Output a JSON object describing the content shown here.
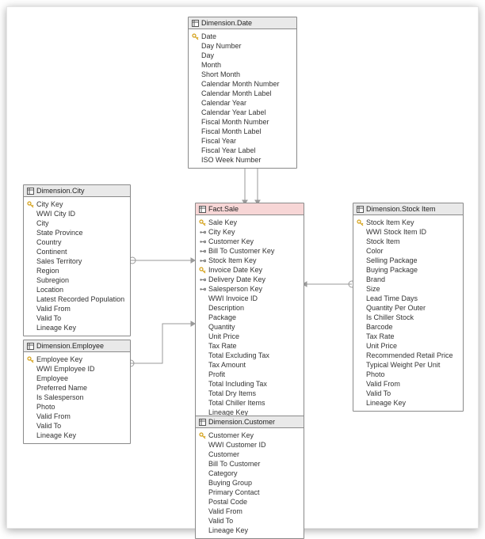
{
  "tables": {
    "date": {
      "title": "Dimension.Date",
      "columns": [
        {
          "name": "Date",
          "icon": "pk"
        },
        {
          "name": "Day Number",
          "icon": "none"
        },
        {
          "name": "Day",
          "icon": "none"
        },
        {
          "name": "Month",
          "icon": "none"
        },
        {
          "name": "Short Month",
          "icon": "none"
        },
        {
          "name": "Calendar Month Number",
          "icon": "none"
        },
        {
          "name": "Calendar Month Label",
          "icon": "none"
        },
        {
          "name": "Calendar Year",
          "icon": "none"
        },
        {
          "name": "Calendar Year Label",
          "icon": "none"
        },
        {
          "name": "Fiscal Month Number",
          "icon": "none"
        },
        {
          "name": "Fiscal Month Label",
          "icon": "none"
        },
        {
          "name": "Fiscal Year",
          "icon": "none"
        },
        {
          "name": "Fiscal Year Label",
          "icon": "none"
        },
        {
          "name": "ISO Week Number",
          "icon": "none"
        }
      ]
    },
    "city": {
      "title": "Dimension.City",
      "columns": [
        {
          "name": "City Key",
          "icon": "pk"
        },
        {
          "name": "WWI City ID",
          "icon": "none"
        },
        {
          "name": "City",
          "icon": "none"
        },
        {
          "name": "State Province",
          "icon": "none"
        },
        {
          "name": "Country",
          "icon": "none"
        },
        {
          "name": "Continent",
          "icon": "none"
        },
        {
          "name": "Sales Territory",
          "icon": "none"
        },
        {
          "name": "Region",
          "icon": "none"
        },
        {
          "name": "Subregion",
          "icon": "none"
        },
        {
          "name": "Location",
          "icon": "none"
        },
        {
          "name": "Latest Recorded Population",
          "icon": "none"
        },
        {
          "name": "Valid From",
          "icon": "none"
        },
        {
          "name": "Valid To",
          "icon": "none"
        },
        {
          "name": "Lineage Key",
          "icon": "none"
        }
      ]
    },
    "employee": {
      "title": "Dimension.Employee",
      "columns": [
        {
          "name": "Employee Key",
          "icon": "pk"
        },
        {
          "name": "WWI Employee ID",
          "icon": "none"
        },
        {
          "name": "Employee",
          "icon": "none"
        },
        {
          "name": "Preferred Name",
          "icon": "none"
        },
        {
          "name": "Is Salesperson",
          "icon": "none"
        },
        {
          "name": "Photo",
          "icon": "none"
        },
        {
          "name": "Valid From",
          "icon": "none"
        },
        {
          "name": "Valid To",
          "icon": "none"
        },
        {
          "name": "Lineage Key",
          "icon": "none"
        }
      ]
    },
    "sale": {
      "title": "Fact.Sale",
      "columns": [
        {
          "name": "Sale Key",
          "icon": "pk"
        },
        {
          "name": "City Key",
          "icon": "fk"
        },
        {
          "name": "Customer Key",
          "icon": "fk"
        },
        {
          "name": "Bill To Customer Key",
          "icon": "fk"
        },
        {
          "name": "Stock Item Key",
          "icon": "fk"
        },
        {
          "name": "Invoice Date Key",
          "icon": "pk"
        },
        {
          "name": "Delivery Date Key",
          "icon": "fk"
        },
        {
          "name": "Salesperson Key",
          "icon": "fk"
        },
        {
          "name": "WWI Invoice ID",
          "icon": "none"
        },
        {
          "name": "Description",
          "icon": "none"
        },
        {
          "name": "Package",
          "icon": "none"
        },
        {
          "name": "Quantity",
          "icon": "none"
        },
        {
          "name": "Unit Price",
          "icon": "none"
        },
        {
          "name": "Tax Rate",
          "icon": "none"
        },
        {
          "name": "Total Excluding Tax",
          "icon": "none"
        },
        {
          "name": "Tax Amount",
          "icon": "none"
        },
        {
          "name": "Profit",
          "icon": "none"
        },
        {
          "name": "Total Including Tax",
          "icon": "none"
        },
        {
          "name": "Total Dry Items",
          "icon": "none"
        },
        {
          "name": "Total Chiller Items",
          "icon": "none"
        },
        {
          "name": "Lineage Key",
          "icon": "none"
        }
      ]
    },
    "stockitem": {
      "title": "Dimension.Stock Item",
      "columns": [
        {
          "name": "Stock Item Key",
          "icon": "pk"
        },
        {
          "name": "WWI Stock Item ID",
          "icon": "none"
        },
        {
          "name": "Stock Item",
          "icon": "none"
        },
        {
          "name": "Color",
          "icon": "none"
        },
        {
          "name": "Selling Package",
          "icon": "none"
        },
        {
          "name": "Buying Package",
          "icon": "none"
        },
        {
          "name": "Brand",
          "icon": "none"
        },
        {
          "name": "Size",
          "icon": "none"
        },
        {
          "name": "Lead Time Days",
          "icon": "none"
        },
        {
          "name": "Quantity Per Outer",
          "icon": "none"
        },
        {
          "name": "Is Chiller Stock",
          "icon": "none"
        },
        {
          "name": "Barcode",
          "icon": "none"
        },
        {
          "name": "Tax Rate",
          "icon": "none"
        },
        {
          "name": "Unit Price",
          "icon": "none"
        },
        {
          "name": "Recommended Retail Price",
          "icon": "none"
        },
        {
          "name": "Typical Weight Per Unit",
          "icon": "none"
        },
        {
          "name": "Photo",
          "icon": "none"
        },
        {
          "name": "Valid From",
          "icon": "none"
        },
        {
          "name": "Valid To",
          "icon": "none"
        },
        {
          "name": "Lineage Key",
          "icon": "none"
        }
      ]
    },
    "customer": {
      "title": "Dimension.Customer",
      "columns": [
        {
          "name": "Customer Key",
          "icon": "pk"
        },
        {
          "name": "WWI Customer ID",
          "icon": "none"
        },
        {
          "name": "Customer",
          "icon": "none"
        },
        {
          "name": "Bill To Customer",
          "icon": "none"
        },
        {
          "name": "Category",
          "icon": "none"
        },
        {
          "name": "Buying Group",
          "icon": "none"
        },
        {
          "name": "Primary Contact",
          "icon": "none"
        },
        {
          "name": "Postal Code",
          "icon": "none"
        },
        {
          "name": "Valid From",
          "icon": "none"
        },
        {
          "name": "Valid To",
          "icon": "none"
        },
        {
          "name": "Lineage Key",
          "icon": "none"
        }
      ]
    }
  }
}
